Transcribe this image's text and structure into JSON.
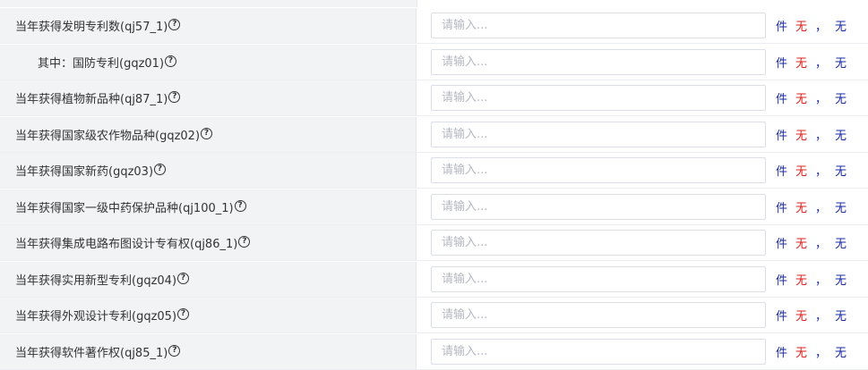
{
  "rows": [
    {
      "label": "当年获得发明专利数(qj57_1)",
      "help": "?",
      "placeholder": "请输入...",
      "unit": "件",
      "status": "无",
      "sep": "，",
      "status2": "无",
      "sub": false
    },
    {
      "label": "其中：国防专利(gqz01)",
      "help": "?",
      "placeholder": "请输入...",
      "unit": "件",
      "status": "无",
      "sep": "，",
      "status2": "无",
      "sub": true
    },
    {
      "label": "当年获得植物新品种(qj87_1)",
      "help": "?",
      "placeholder": "请输入...",
      "unit": "件",
      "status": "无",
      "sep": "，",
      "status2": "无",
      "sub": false
    },
    {
      "label": "当年获得国家级农作物品种(gqz02)",
      "help": "?",
      "placeholder": "请输入...",
      "unit": "件",
      "status": "无",
      "sep": "，",
      "status2": "无",
      "sub": false
    },
    {
      "label": "当年获得国家新药(gqz03)",
      "help": "?",
      "placeholder": "请输入...",
      "unit": "件",
      "status": "无",
      "sep": "，",
      "status2": "无",
      "sub": false
    },
    {
      "label": "当年获得国家一级中药保护品种(qj100_1)",
      "help": "?",
      "placeholder": "请输入...",
      "unit": "件",
      "status": "无",
      "sep": "，",
      "status2": "无",
      "sub": false
    },
    {
      "label": "当年获得集成电路布图设计专有权(qj86_1)",
      "help": "?",
      "placeholder": "请输入...",
      "unit": "件",
      "status": "无",
      "sep": "，",
      "status2": "无",
      "sub": false
    },
    {
      "label": "当年获得实用新型专利(gqz04)",
      "help": "?",
      "placeholder": "请输入...",
      "unit": "件",
      "status": "无",
      "sep": "，",
      "status2": "无",
      "sub": false
    },
    {
      "label": "当年获得外观设计专利(gqz05)",
      "help": "?",
      "placeholder": "请输入...",
      "unit": "件",
      "status": "无",
      "sep": "，",
      "status2": "无",
      "sub": false
    },
    {
      "label": "当年获得软件著作权(qj85_1)",
      "help": "?",
      "placeholder": "请输入...",
      "unit": "件",
      "status": "无",
      "sep": "，",
      "status2": "无",
      "sub": false
    }
  ],
  "colors": {
    "label_bg": "#f2f3f5",
    "unit_blue": "#1b2aa8",
    "status_red": "#e0201b",
    "border": "#dcdfe6"
  }
}
